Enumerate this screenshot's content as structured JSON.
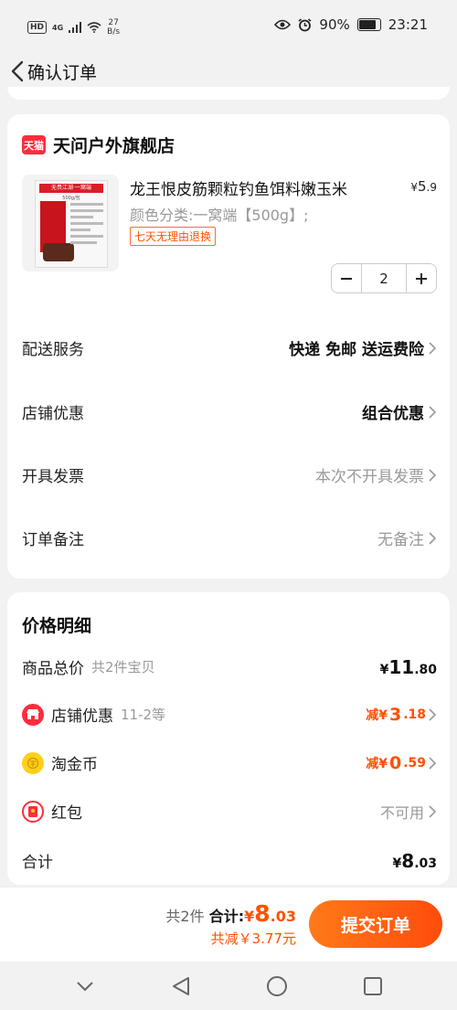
{
  "status_bar": {
    "hd": "HD",
    "network": "4G",
    "speed_value": "27",
    "speed_unit": "B/s",
    "battery": "90%",
    "time": "23:21"
  },
  "header": {
    "title": "确认订单"
  },
  "store": {
    "logo_text": "天猫",
    "name": "天问户外旗舰店",
    "product": {
      "title": "龙王恨皮筋颗粒钓鱼饵料嫩玉米",
      "price_symbol": "¥",
      "price_int": "5",
      "price_dec": ".9",
      "variant": "颜色分类:一窝端【500g】;",
      "tag": "七天无理由退换",
      "image_banner": "无畏江湖·一窝端",
      "image_sub": "500g/包",
      "quantity": "2"
    },
    "rows": [
      {
        "label": "配送服务",
        "value": "快递 免邮 送运费险"
      },
      {
        "label": "店铺优惠",
        "value": "组合优惠"
      },
      {
        "label": "开具发票",
        "value": "本次不开具发票"
      },
      {
        "label": "订单备注",
        "value": "无备注"
      }
    ]
  },
  "price_detail": {
    "title": "价格明细",
    "goods_total_label": "商品总价",
    "goods_total_sub": "共2件宝贝",
    "goods_total_symbol": "¥",
    "goods_total_int": "11",
    "goods_total_dec": ".80",
    "store_discount_label": "店铺优惠",
    "store_discount_sub": "11-2等",
    "store_discount_prefix": "减¥",
    "store_discount_int": "3",
    "store_discount_dec": ".18",
    "coin_label": "淘金币",
    "coin_prefix": "减¥",
    "coin_int": "0",
    "coin_dec": ".59",
    "redpacket_label": "红包",
    "redpacket_value": "不可用",
    "sum_label": "合计",
    "sum_symbol": "¥",
    "sum_int": "8",
    "sum_dec": ".03"
  },
  "bottom_bar": {
    "count": "共2件",
    "total_label": "合计:",
    "total_symbol": "¥",
    "total_int": "8",
    "total_dec": ".03",
    "saved": "共减￥3.77元",
    "submit": "提交订单"
  },
  "colors": {
    "accent": "#ff5000",
    "tmall_red": "#ff2c3d",
    "coin_yellow": "#ffcf1a"
  }
}
